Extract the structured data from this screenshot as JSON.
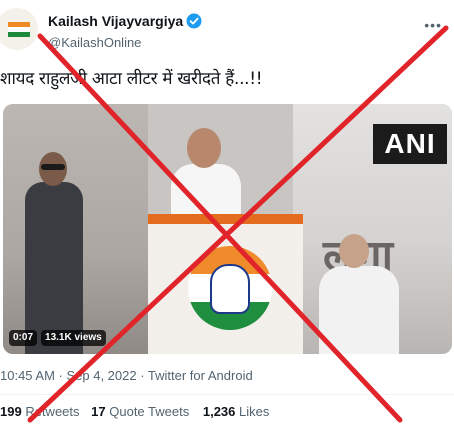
{
  "author": {
    "name": "Kailash Vijayvargiya",
    "handle": "@KailashOnline"
  },
  "tweet": {
    "text": "शायद राहुलजी आटा लीटर में खरीदते हैं...!!",
    "meta": "10:45 AM · Sep 4, 2022 · Twitter for Android"
  },
  "media": {
    "duration": "0:07",
    "views": "13.1K views",
    "watermark": "ANI"
  },
  "stats": {
    "retweets_count": "199",
    "retweets_label": "Retweets",
    "quotes_count": "17",
    "quotes_label": "Quote Tweets",
    "likes_count": "1,236",
    "likes_label": "Likes"
  },
  "colors": {
    "cross": "#e0242a",
    "verified": "#1d9bf0"
  }
}
